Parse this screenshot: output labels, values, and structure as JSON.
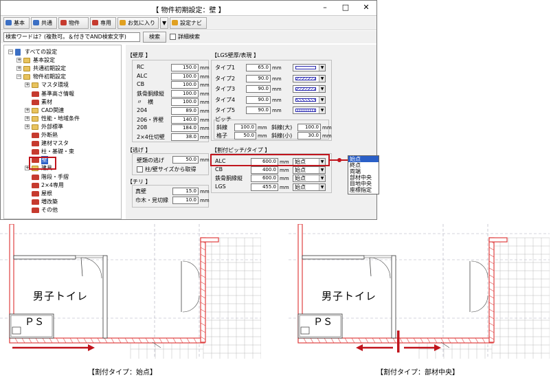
{
  "window": {
    "title": "【 物件初期設定：壁 】",
    "minimize": "–",
    "maximize": "□",
    "close": "✕"
  },
  "toolbar": [
    {
      "label": "基本",
      "color": "#3b6fc4"
    },
    {
      "label": "共通",
      "color": "#3b6fc4"
    },
    {
      "label": "物件",
      "color": "#c63a2e"
    },
    {
      "label": "専用",
      "color": "#c63a2e"
    },
    {
      "label": "お気に入り",
      "color": "#e0a020"
    },
    {
      "label": "▼",
      "color": ""
    },
    {
      "label": "設定ナビ",
      "color": "#e0a020"
    }
  ],
  "search": {
    "value": "検索ワードは？(複数可。＆付きでAND検索文字)",
    "button": "検索",
    "detail_label": "詳細検索"
  },
  "tree": [
    {
      "label": "すべての設定",
      "exp": "⊟",
      "type": "root",
      "indent": 0
    },
    {
      "label": "基本設定",
      "exp": "⊞",
      "type": "folder",
      "indent": 1
    },
    {
      "label": "共通初期設定",
      "exp": "⊞",
      "type": "folder",
      "indent": 1
    },
    {
      "label": "物件初期設定",
      "exp": "⊟",
      "type": "folder",
      "indent": 1
    },
    {
      "label": "マスタ環境",
      "exp": "⊞",
      "type": "folder",
      "indent": 2
    },
    {
      "label": "基準高さ情報",
      "exp": "",
      "type": "item",
      "indent": 2
    },
    {
      "label": "素材",
      "exp": "",
      "type": "item",
      "indent": 2
    },
    {
      "label": "CAD関連",
      "exp": "⊞",
      "type": "folder",
      "indent": 2
    },
    {
      "label": "性能・地域条件",
      "exp": "⊞",
      "type": "folder",
      "indent": 2
    },
    {
      "label": "外部標準",
      "exp": "⊞",
      "type": "folder",
      "indent": 2
    },
    {
      "label": "外断熱",
      "exp": "",
      "type": "item",
      "indent": 2
    },
    {
      "label": "建材マスタ",
      "exp": "",
      "type": "item",
      "indent": 2
    },
    {
      "label": "柱・基礎・束",
      "exp": "",
      "type": "item",
      "indent": 2
    },
    {
      "label": "壁",
      "exp": "",
      "type": "item",
      "indent": 2,
      "selected": true
    },
    {
      "label": "建具",
      "exp": "⊞",
      "type": "folder",
      "indent": 2
    },
    {
      "label": "階段・手摺",
      "exp": "",
      "type": "item",
      "indent": 2
    },
    {
      "label": "2×4専用",
      "exp": "",
      "type": "item",
      "indent": 2
    },
    {
      "label": "屋根",
      "exp": "",
      "type": "item",
      "indent": 2
    },
    {
      "label": "増改築",
      "exp": "",
      "type": "item",
      "indent": 2
    },
    {
      "label": "その他",
      "exp": "",
      "type": "item",
      "indent": 2
    }
  ],
  "wall_thickness": {
    "title": "【壁厚 】",
    "unit": "mm",
    "rows": [
      {
        "label": "RC",
        "value": "150.0"
      },
      {
        "label": "ALC",
        "value": "100.0"
      },
      {
        "label": "CB",
        "value": "100.0"
      },
      {
        "label": "鉄骨胴縁縦",
        "value": "100.0"
      },
      {
        "label": "〃　横",
        "value": "100.0"
      },
      {
        "label": "204",
        "value": "89.0"
      },
      {
        "label": "206・界壁",
        "value": "140.0"
      },
      {
        "label": "208",
        "value": "184.0"
      },
      {
        "label": "2×4仕切壁",
        "value": "38.0"
      }
    ]
  },
  "lgs": {
    "title": "【LGS壁厚/表現 】",
    "unit": "mm",
    "types": [
      {
        "label": "タイプ1",
        "value": "65.0",
        "pattern": "empty"
      },
      {
        "label": "タイプ2",
        "value": "90.0",
        "pattern": "hatch"
      },
      {
        "label": "タイプ3",
        "value": "90.0",
        "pattern": "hatch"
      },
      {
        "label": "タイプ4",
        "value": "90.0",
        "pattern": "cross"
      },
      {
        "label": "タイプ5",
        "value": "90.0",
        "pattern": "grid"
      }
    ],
    "pitch_title": "ピッチ",
    "pitch": [
      {
        "label": "斜線",
        "value": "100.0",
        "label2": "斜線(大)",
        "value2": "100.0"
      },
      {
        "label": "格子",
        "value": "50.0",
        "label2": "斜線(小)",
        "value2": "30.0"
      }
    ]
  },
  "nige": {
    "title": "【逃げ 】",
    "label": "壁類の逃げ",
    "value": "50.0",
    "unit": "mm",
    "check": "柱/壁サイズから取得"
  },
  "chiri": {
    "title": "【チリ 】",
    "unit": "mm",
    "rows": [
      {
        "label": "真壁",
        "value": "15.0"
      },
      {
        "label": "巾木・見切縁",
        "value": "10.0"
      }
    ]
  },
  "split": {
    "title": "【割付ピッチ/タイプ 】",
    "unit": "mm",
    "rows": [
      {
        "label": "ALC",
        "value": "600.0",
        "type": "始点"
      },
      {
        "label": "CB",
        "value": "400.0",
        "type": "始点"
      },
      {
        "label": "鉄骨胴縁縦",
        "value": "600.0",
        "type": "始点"
      },
      {
        "label": "LGS",
        "value": "455.0",
        "type": "始点"
      }
    ]
  },
  "dropdown": {
    "options": [
      "始点",
      "終点",
      "両端",
      "部材中央",
      "目地中央",
      "座標指定"
    ],
    "selected": 0
  },
  "plans": [
    {
      "room": "男子トイレ",
      "ps": "ＰＳ",
      "caption": "【割付タイプ：始点】"
    },
    {
      "room": "男子トイレ",
      "ps": "ＰＳ",
      "caption": "【割付タイプ：部材中央】"
    }
  ],
  "colors": {
    "accent": "#c0141c",
    "wall": "#e04040",
    "selection": "#2a5fc7"
  }
}
